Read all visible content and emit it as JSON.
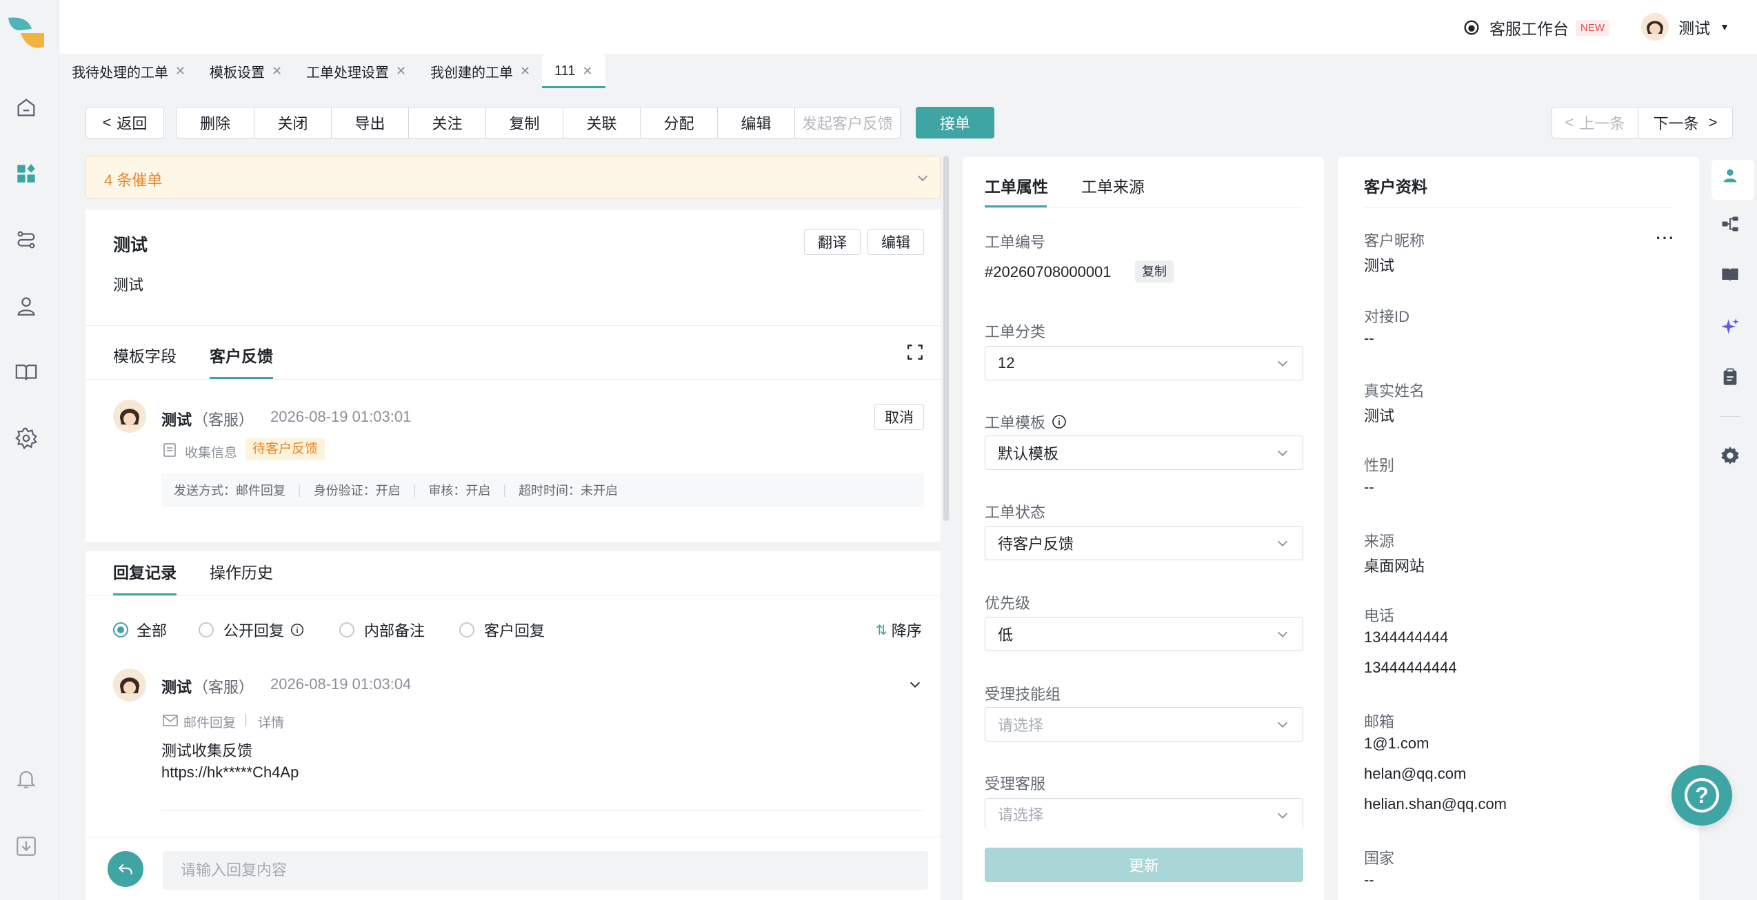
{
  "header": {
    "workspace_label": "客服工作台",
    "new_badge": "NEW",
    "user_name": "测试"
  },
  "tabs": [
    {
      "label": "我待处理的工单"
    },
    {
      "label": "模板设置"
    },
    {
      "label": "工单处理设置"
    },
    {
      "label": "我创建的工单"
    },
    {
      "label": "111"
    }
  ],
  "toolbar": {
    "back": "返回",
    "actions": [
      "删除",
      "关闭",
      "导出",
      "关注",
      "复制",
      "关联",
      "分配",
      "编辑",
      "发起客户反馈"
    ],
    "accept": "接单",
    "prev": "上一条",
    "next": "下一条"
  },
  "reminder": {
    "text": "4 条催单"
  },
  "ticket": {
    "title": "测试",
    "body": "测试",
    "translate": "翻译",
    "edit": "编辑"
  },
  "detail_tabs": {
    "template_fields": "模板字段",
    "customer_feedback": "客户反馈"
  },
  "feedback": {
    "author": "测试",
    "role": "（客服）",
    "time": "2026-08-19 01:03:01",
    "cancel": "取消",
    "collect": "收集信息",
    "status": "待客户反馈",
    "meta": [
      "发送方式：邮件回复",
      "身份验证：开启",
      "审核：开启",
      "超时时间：未开启"
    ]
  },
  "record_tabs": {
    "replies": "回复记录",
    "history": "操作历史"
  },
  "filters": {
    "all": "全部",
    "public": "公开回复",
    "internal": "内部备注",
    "customer": "客户回复",
    "sort": "降序"
  },
  "reply": {
    "author": "测试",
    "role": "（客服）",
    "time": "2026-08-19 01:03:04",
    "channel": "邮件回复",
    "detail": "详情",
    "line1": "测试收集反馈",
    "line2": "https://hk*****Ch4Ap"
  },
  "reply_input": {
    "placeholder": "请输入回复内容"
  },
  "props": {
    "tab_attr": "工单属性",
    "tab_source": "工单来源",
    "id_label": "工单编号",
    "id_value": "#20260708000001",
    "copy": "复制",
    "category_label": "工单分类",
    "category_value": "12",
    "template_label": "工单模板",
    "template_value": "默认模板",
    "status_label": "工单状态",
    "status_value": "待客户反馈",
    "priority_label": "优先级",
    "priority_value": "低",
    "group_label": "受理技能组",
    "group_placeholder": "请选择",
    "agent_label": "受理客服",
    "agent_placeholder": "请选择",
    "update": "更新"
  },
  "customer": {
    "title": "客户资料",
    "fields": [
      {
        "label": "客户昵称",
        "values": [
          "测试"
        ]
      },
      {
        "label": "对接ID",
        "values": [
          "--"
        ]
      },
      {
        "label": "真实姓名",
        "values": [
          "测试"
        ]
      },
      {
        "label": "性别",
        "values": [
          "--"
        ]
      },
      {
        "label": "来源",
        "values": [
          "桌面网站"
        ]
      },
      {
        "label": "电话",
        "values": [
          "1344444444",
          "13444444444"
        ]
      },
      {
        "label": "邮箱",
        "values": [
          "1@1.com",
          "helan@qq.com",
          "helian.shan@qq.com"
        ]
      },
      {
        "label": "国家",
        "values": [
          "--"
        ]
      }
    ]
  },
  "colors": {
    "accent": "#3ea4a4",
    "warning_bg": "#fef6e7",
    "warning_text": "#e8862a"
  }
}
